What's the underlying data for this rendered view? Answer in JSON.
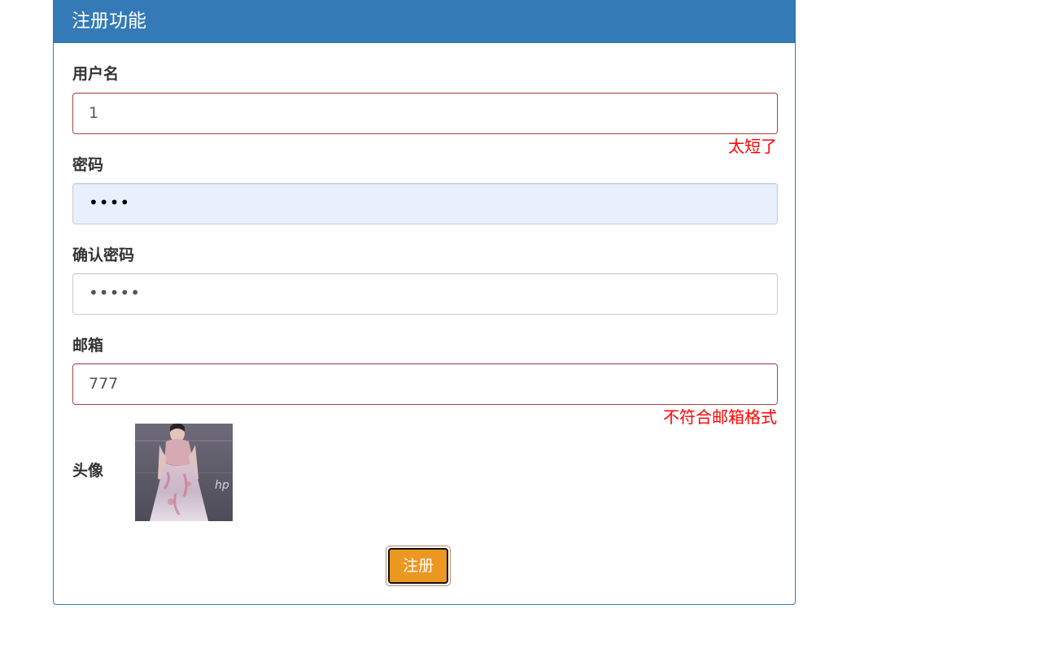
{
  "panel": {
    "title": "注册功能"
  },
  "form": {
    "username": {
      "label": "用户名",
      "value": "1",
      "error": "太短了"
    },
    "password": {
      "label": "密码",
      "value": "••••"
    },
    "confirm_password": {
      "label": "确认密码",
      "value": "•••••"
    },
    "email": {
      "label": "邮箱",
      "value": "777",
      "error": "不符合邮箱格式"
    },
    "avatar": {
      "label": "头像"
    },
    "submit_label": "注册"
  },
  "colors": {
    "primary": "#337ab7",
    "error_text": "#ff0000",
    "error_border": "#a94442",
    "warning_button": "#ec971f",
    "autofill_bg": "#e8f0fe"
  }
}
